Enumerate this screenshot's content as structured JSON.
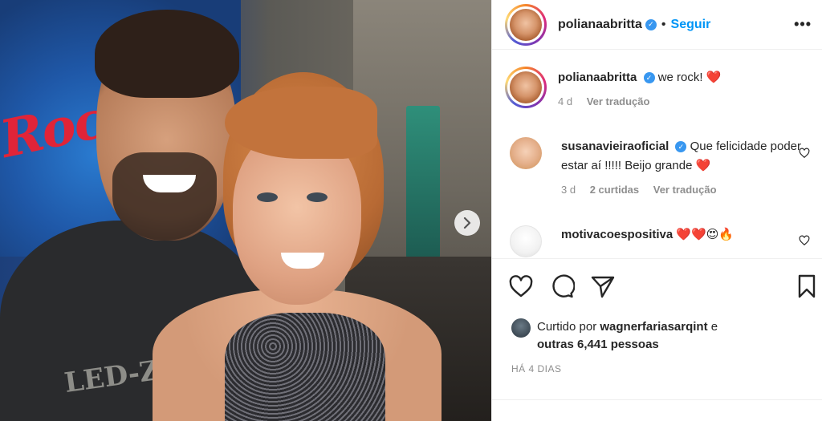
{
  "post": {
    "author": "polianaabritta",
    "follow_label": "Seguir",
    "more_label": "•••",
    "verified_mark": "✓"
  },
  "photo": {
    "sign_text": "Rock",
    "shirt_print": "LED-Z"
  },
  "comments": [
    {
      "user": "polianaabritta",
      "text": "we rock!",
      "emoji": "❤️",
      "time": "4 d",
      "translate": "Ver tradução"
    },
    {
      "user": "susanavieiraoficial",
      "text": "Que felicidade poder estar aí !!!!! Beijo grande",
      "emoji": "❤️",
      "time": "3 d",
      "likes": "2 curtidas",
      "translate": "Ver tradução"
    },
    {
      "user": "motivacoespositiva",
      "text": "",
      "emoji": "❤️❤️😍🔥"
    }
  ],
  "likes": {
    "prefix": "Curtido por",
    "user": "wagnerfariasarqint",
    "connector": "e",
    "others": "outras 6,441 pessoas"
  },
  "date": "HÁ 4 DIAS",
  "colors": {
    "accent": "#0095f6",
    "heart": "#ed4956",
    "muted": "#8e8e8e"
  },
  "icons": [
    "heart-icon",
    "comment-icon",
    "share-icon",
    "bookmark-icon",
    "more-icon",
    "chevron-right-icon",
    "verified-icon"
  ]
}
